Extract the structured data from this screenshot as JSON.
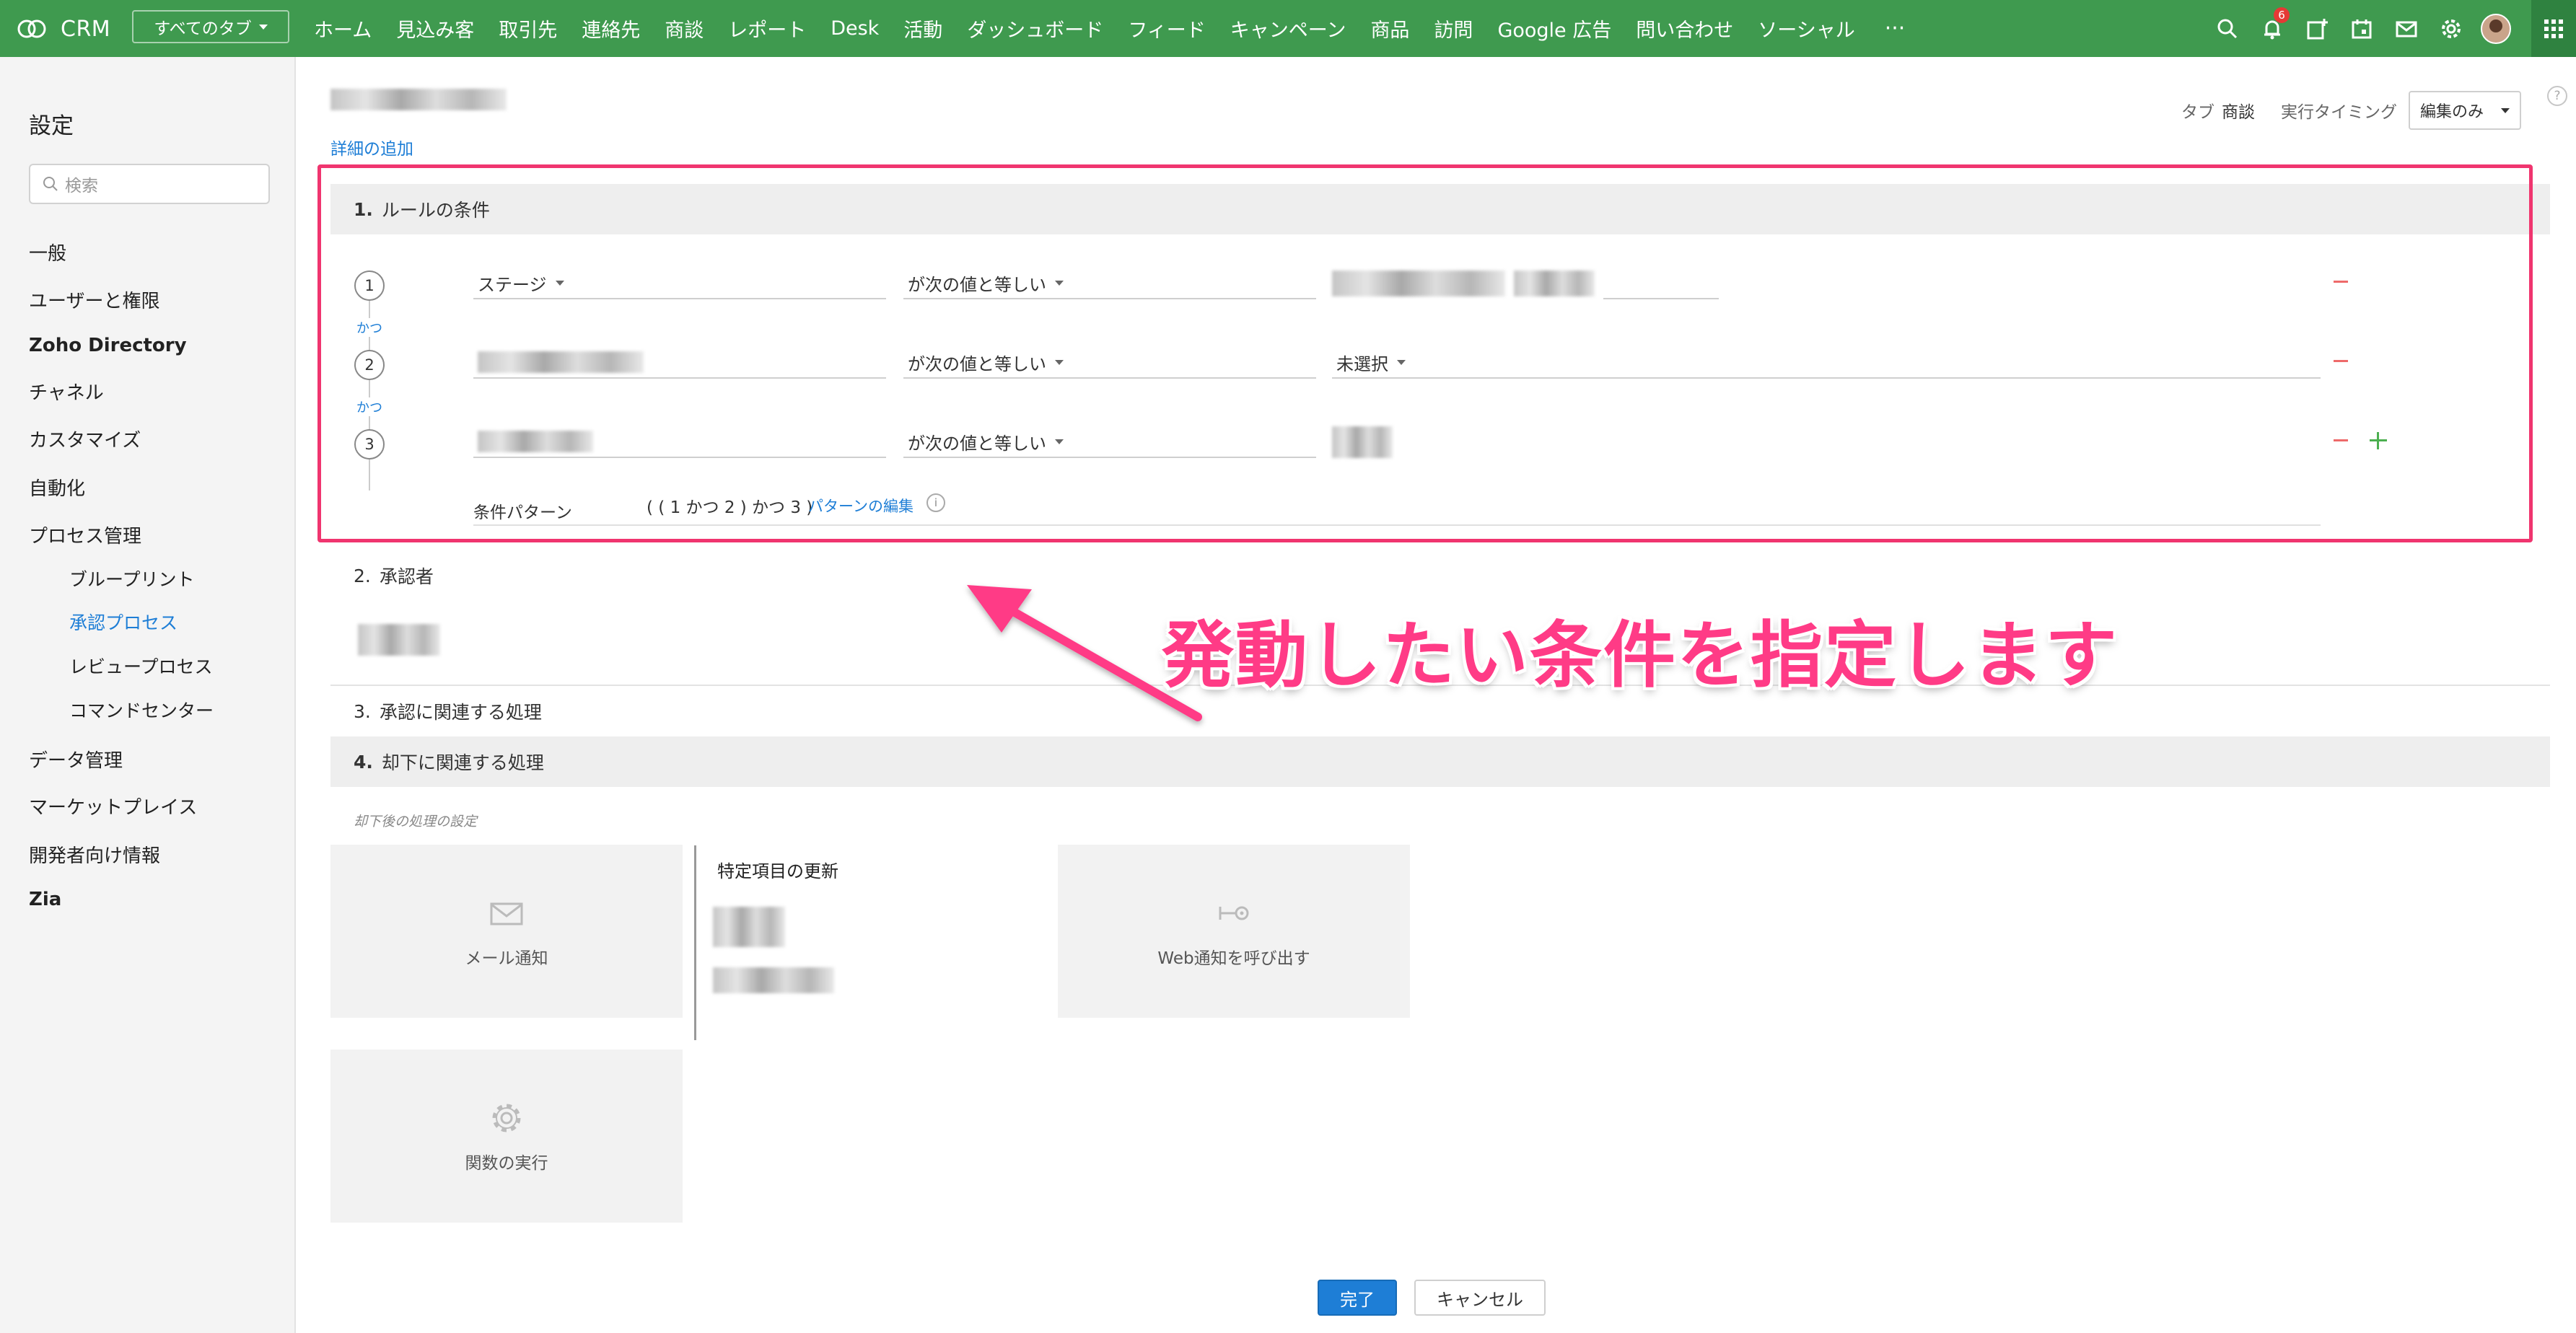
{
  "topbar": {
    "app_name": "CRM",
    "all_tabs": "すべてのタブ",
    "tabs": [
      "ホーム",
      "見込み客",
      "取引先",
      "連絡先",
      "商談",
      "レポート",
      "Desk",
      "活動",
      "ダッシュボード",
      "フィード",
      "キャンペーン",
      "商品",
      "訪問",
      "Google 広告",
      "問い合わせ",
      "ソーシャル"
    ],
    "more": "···",
    "notification_count": "6",
    "brand_color": "#3f9a4f"
  },
  "sidebar": {
    "title": "設定",
    "search_placeholder": "検索",
    "items": [
      "一般",
      "ユーザーと権限",
      "Zoho Directory",
      "チャネル",
      "カスタマイズ",
      "自動化",
      "プロセス管理",
      "ブループリント",
      "承認プロセス",
      "レビュープロセス",
      "コマンドセンター",
      "データ管理",
      "マーケットプレイス",
      "開発者向け情報",
      "Zia"
    ]
  },
  "header": {
    "add_detail": "詳細の追加",
    "tab_label": "タブ",
    "tab_value": "商談",
    "timing_label": "実行タイミング",
    "timing_value": "編集のみ",
    "help": "?"
  },
  "rule": {
    "number": "1.",
    "title": "ルールの条件",
    "conditions": [
      {
        "num": "1",
        "field": "ステージ",
        "operator": "が次の値と等しい",
        "value": ""
      },
      {
        "num": "2",
        "field": "",
        "operator": "が次の値と等しい",
        "value": "未選択"
      },
      {
        "num": "3",
        "field": "",
        "operator": "が次の値と等しい",
        "value": ""
      }
    ],
    "join": "かつ",
    "pattern_label": "条件パターン",
    "pattern_value": "( ( 1 かつ 2 ) かつ 3 )",
    "pattern_edit": "パターンの編集",
    "info": "i"
  },
  "approver": {
    "number": "2.",
    "title": "承認者"
  },
  "approval_actions": {
    "number": "3.",
    "title": "承認に関連する処理"
  },
  "reject_actions": {
    "number": "4.",
    "title": "却下に関連する処理",
    "after_label": "却下後の処理の設定",
    "email": "メール通知",
    "field_update": "特定項目の更新",
    "webhook": "Web通知を呼び出す",
    "function": "関数の実行"
  },
  "annotation": {
    "text": "発動したい条件を指定します",
    "color": "#ff3b86"
  },
  "buttons": {
    "done": "完了",
    "cancel": "キャンセル"
  }
}
